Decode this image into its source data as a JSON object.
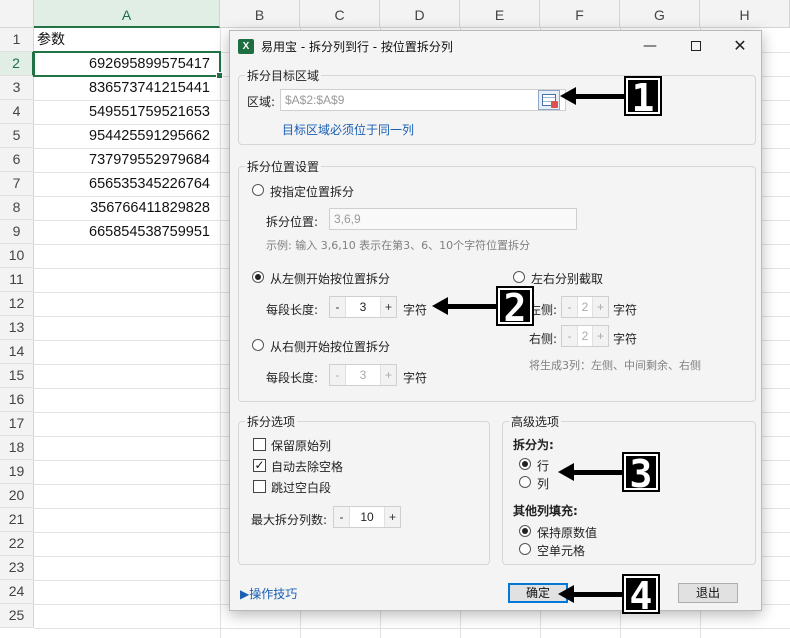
{
  "sheet": {
    "columns": [
      "A",
      "B",
      "C",
      "D",
      "E",
      "F",
      "G",
      "H"
    ],
    "rows": [
      "1",
      "2",
      "3",
      "4",
      "5",
      "6",
      "7",
      "8",
      "9",
      "10",
      "11",
      "12",
      "13",
      "14",
      "15",
      "16",
      "17",
      "18",
      "19",
      "20",
      "21",
      "22",
      "23",
      "24",
      "25"
    ],
    "header_cell": "参数",
    "values": [
      "692695899575417",
      "836573741215441",
      "549551759521653",
      "954425591295662",
      "737979552979684",
      "656535345226764",
      "356766411829828",
      "665854538759951"
    ]
  },
  "dialog": {
    "app_icon": "X",
    "title": "易用宝 - 拆分列到行 - 按位置拆分列",
    "window_buttons": {
      "minimize": "—",
      "close": "✕"
    },
    "target": {
      "legend": "拆分目标区域",
      "range_label": "区域:",
      "range_value": "$A$2:$A$9",
      "note": "目标区域必须位于同一列"
    },
    "position_settings": {
      "legend": "拆分位置设置",
      "by_position_label": "按指定位置拆分",
      "split_positions_label": "拆分位置:",
      "split_positions_placeholder": "3,6,9",
      "example": "示例: 输入 3,6,10 表示在第3、6、10个字符位置拆分",
      "from_left_label": "从左侧开始按位置拆分",
      "seg_length_label": "每段长度:",
      "left_value": "3",
      "chars_unit": "字符",
      "from_right_label": "从右侧开始按位置拆分",
      "right_value": "3",
      "both_sides_label": "左右分别截取",
      "left_side_label": "左侧:",
      "left_side_value": "2",
      "right_side_label": "右侧:",
      "right_side_value": "2",
      "both_note": "将生成3列：左侧、中间剩余、右侧"
    },
    "split_options": {
      "legend": "拆分选项",
      "keep_original": "保留原始列",
      "auto_trim": "自动去除空格",
      "skip_blank": "跳过空白段",
      "max_cols_label": "最大拆分列数:",
      "max_cols_value": "10"
    },
    "advanced": {
      "legend": "高级选项",
      "split_to_label": "拆分为:",
      "to_row": "行",
      "to_col": "列",
      "other_fill_label": "其他列填充:",
      "keep_value": "保持原数值",
      "empty_cell": "空单元格"
    },
    "footer": {
      "tips_link": "▶操作技巧",
      "ok": "确定",
      "exit": "退出"
    }
  },
  "callouts": [
    "1",
    "2",
    "3",
    "4"
  ]
}
